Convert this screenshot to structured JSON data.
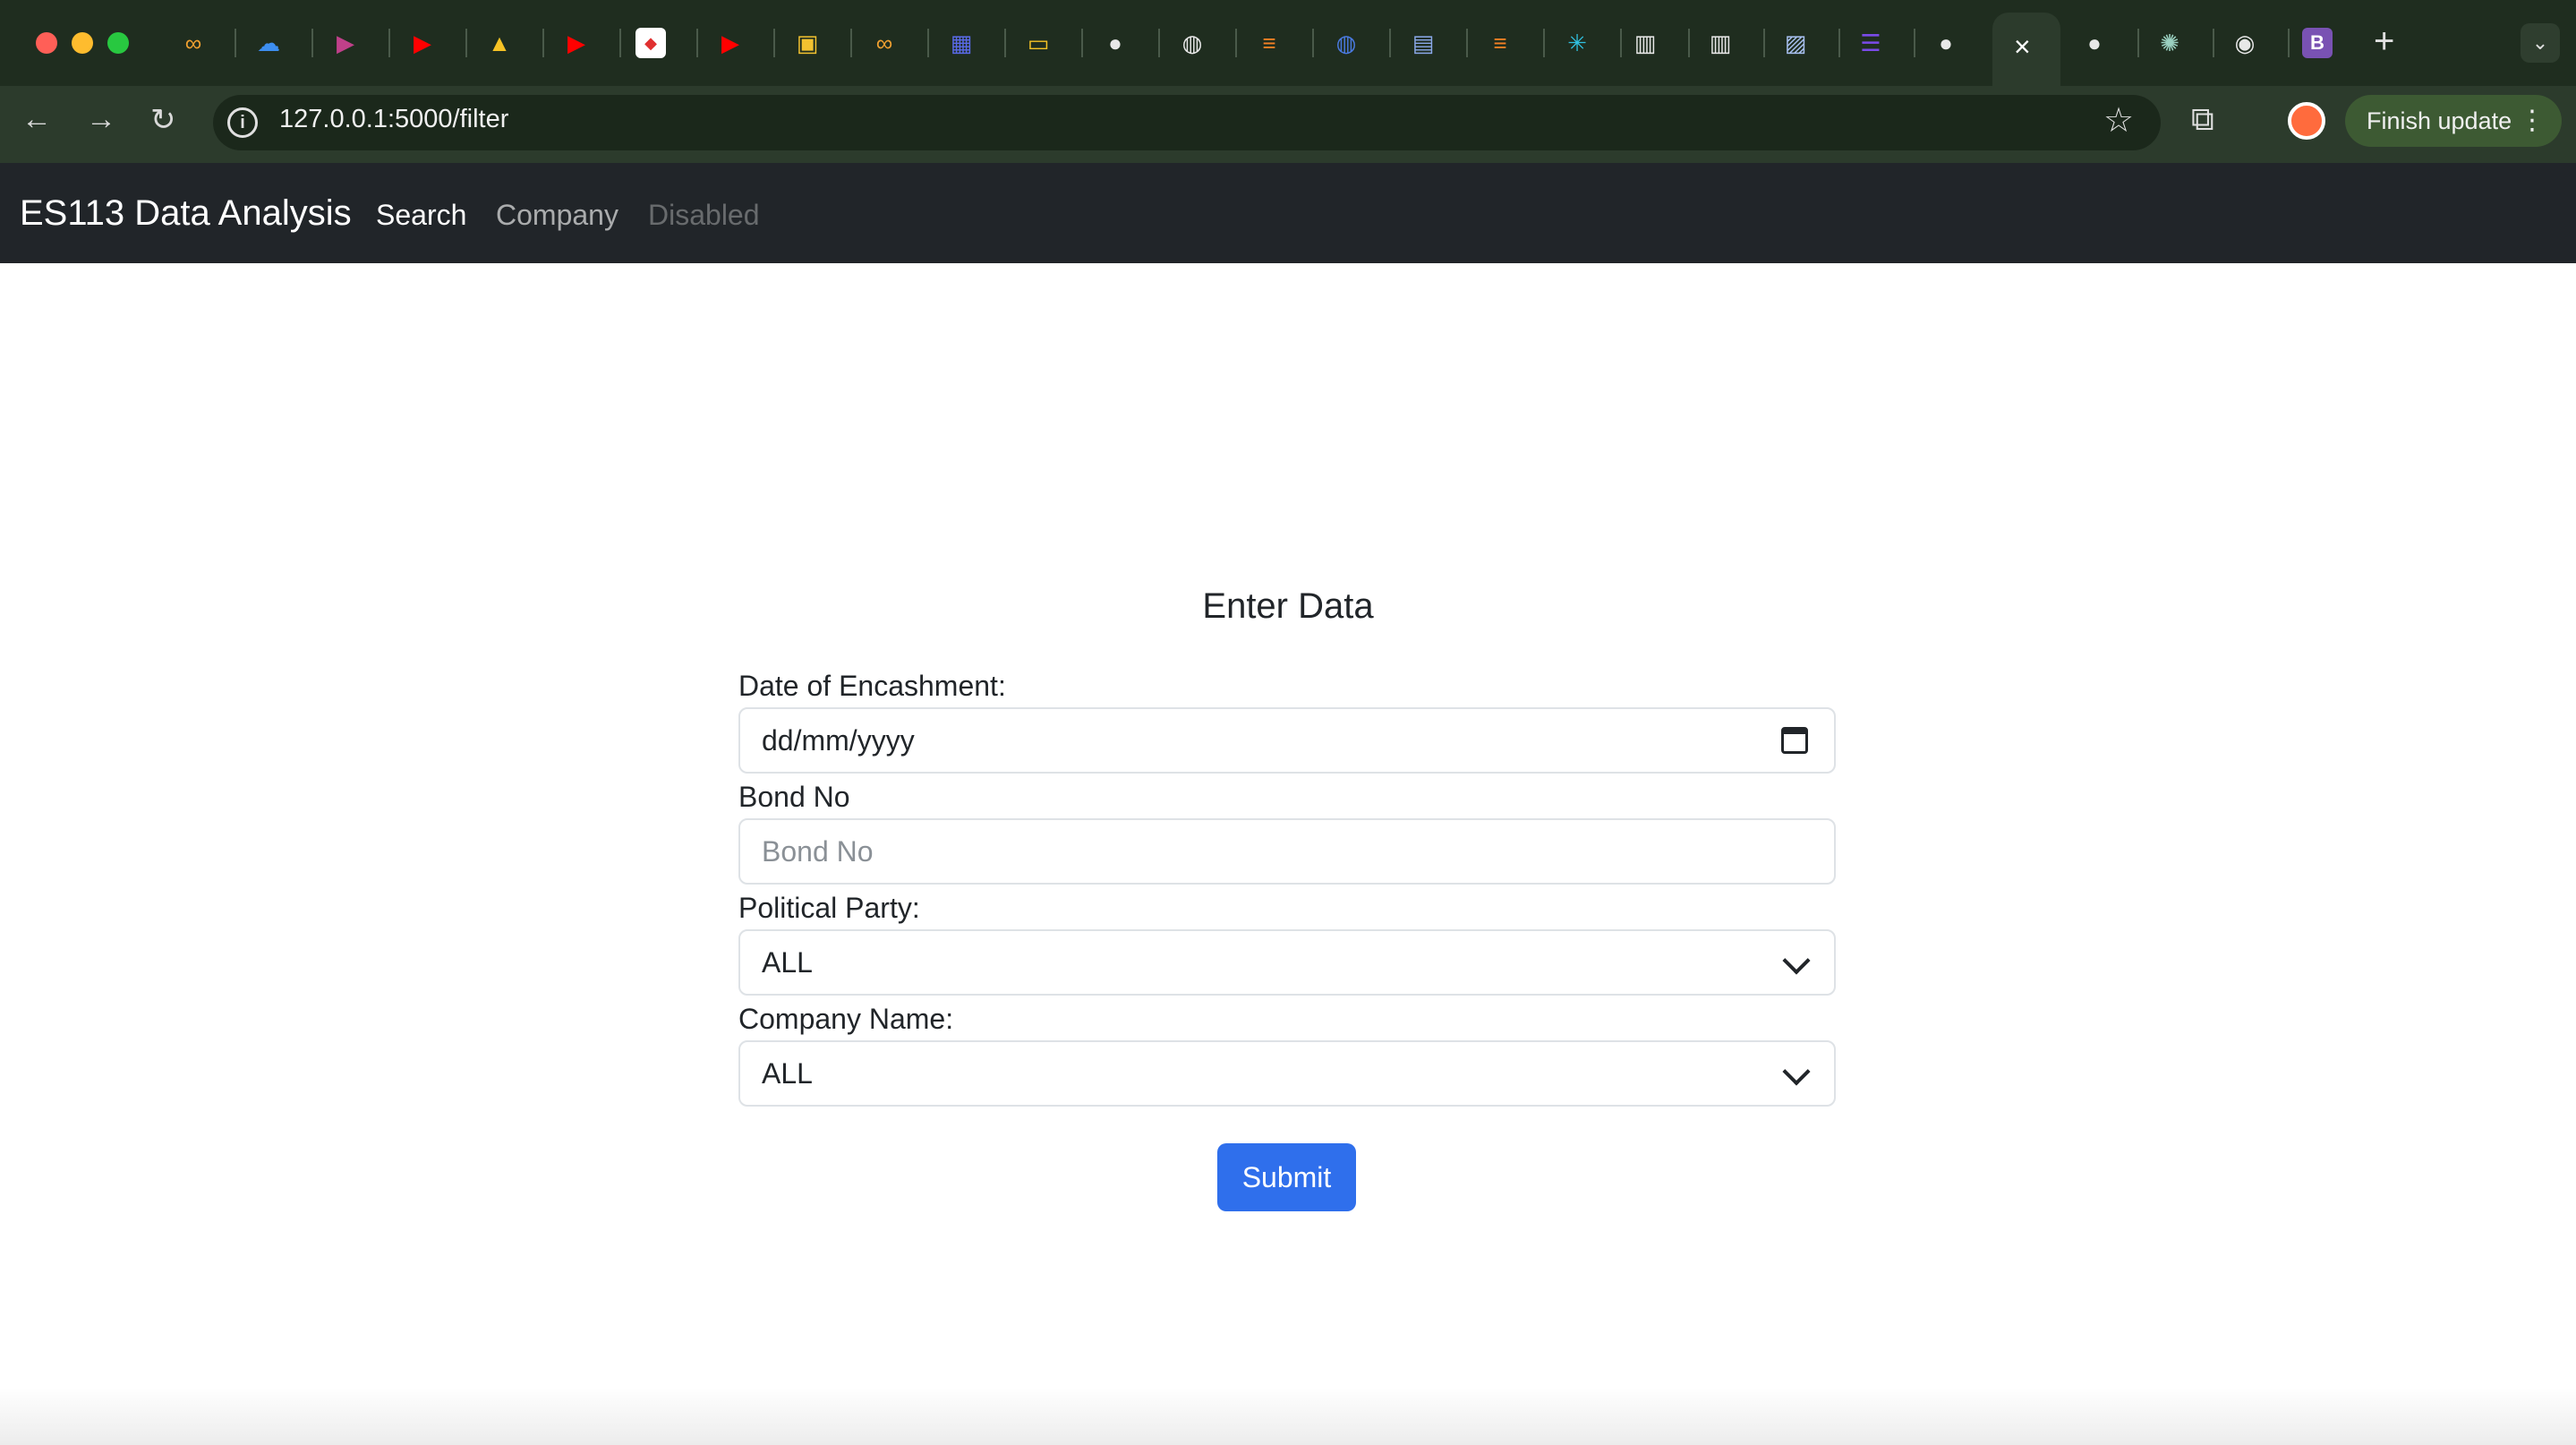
{
  "browser": {
    "url": "127.0.0.1:5000/filter",
    "update_button": "Finish update",
    "new_tab_label": "+",
    "close_tab_label": "×",
    "tab_icons": [
      "infinity-icon",
      "cloud-icon",
      "play-icon",
      "youtube-icon",
      "drive-icon",
      "youtube-icon",
      "web-icon",
      "youtube-icon",
      "photo-icon",
      "infinity-icon",
      "layout-icon",
      "slides-icon",
      "github-icon",
      "globe-icon",
      "stackoverflow-icon",
      "globe-icon",
      "terminal-icon",
      "stackoverflow-icon",
      "asterisk-icon",
      "book-icon",
      "book-icon",
      "image-icon",
      "list-icon",
      "github-icon",
      "github-icon",
      "openai-icon",
      "chrome-icon",
      "bootstrap-icon"
    ]
  },
  "navbar": {
    "brand": "ES113 Data Analysis",
    "links": [
      "Search",
      "Company",
      "Disabled"
    ]
  },
  "form": {
    "title": "Enter Data",
    "date_label": "Date of Encashment:",
    "date_placeholder": "dd/mm/yyyy",
    "bond_label": "Bond No",
    "bond_placeholder": "Bond No",
    "party_label": "Political Party:",
    "party_value": "ALL",
    "company_label": "Company Name:",
    "company_value": "ALL",
    "submit_label": "Submit"
  },
  "colors": {
    "navbar_bg": "#212529",
    "primary": "#2f6fec",
    "chrome_bg": "#1f2d1f"
  }
}
